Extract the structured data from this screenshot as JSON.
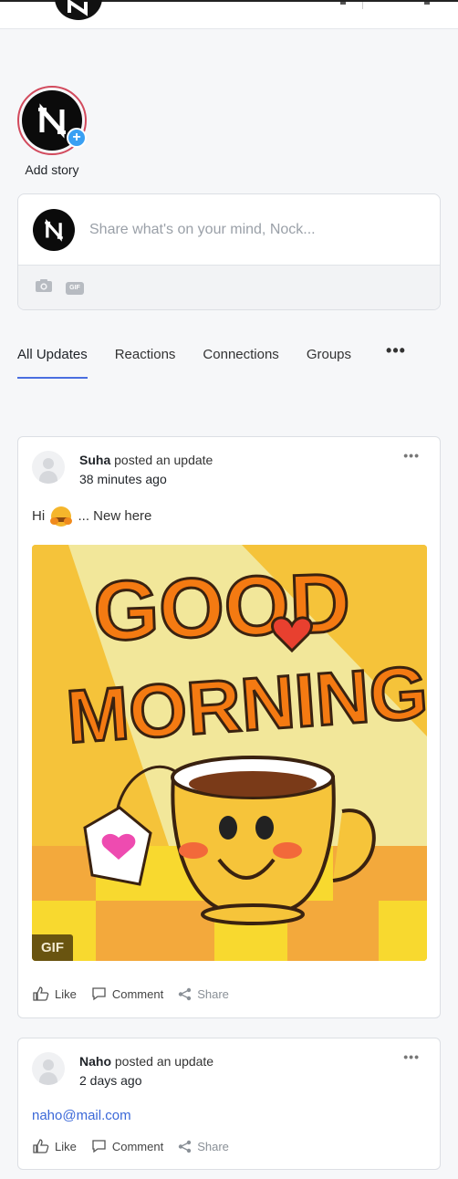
{
  "user": {
    "name": "Nock"
  },
  "story": {
    "label": "Add story"
  },
  "composer": {
    "placeholder": "Share what's on your mind, Nock...",
    "gif_label": "GIF"
  },
  "tabs": [
    {
      "label": "All Updates",
      "active": true
    },
    {
      "label": "Reactions"
    },
    {
      "label": "Connections"
    },
    {
      "label": "Groups"
    }
  ],
  "more_label": "•••",
  "posts": [
    {
      "author": "Suha",
      "action": "posted an update",
      "time": "38 minutes ago",
      "text_before": "Hi",
      "emoji": "hugging-face",
      "text_after": "... New here",
      "media": {
        "type": "gif",
        "badge": "GIF",
        "caption_lines": [
          "GOOD",
          "MORNING"
        ]
      },
      "actions": {
        "like": "Like",
        "comment": "Comment",
        "share": "Share"
      }
    },
    {
      "author": "Naho",
      "action": "posted an update",
      "time": "2 days ago",
      "link": "naho@mail.com",
      "actions": {
        "like": "Like",
        "comment": "Comment",
        "share": "Share"
      }
    }
  ],
  "colors": {
    "accent": "#4a6ee0",
    "link": "#3b68d8",
    "story_ring": "#d24a5d",
    "plus_badge": "#3aa0f3"
  }
}
